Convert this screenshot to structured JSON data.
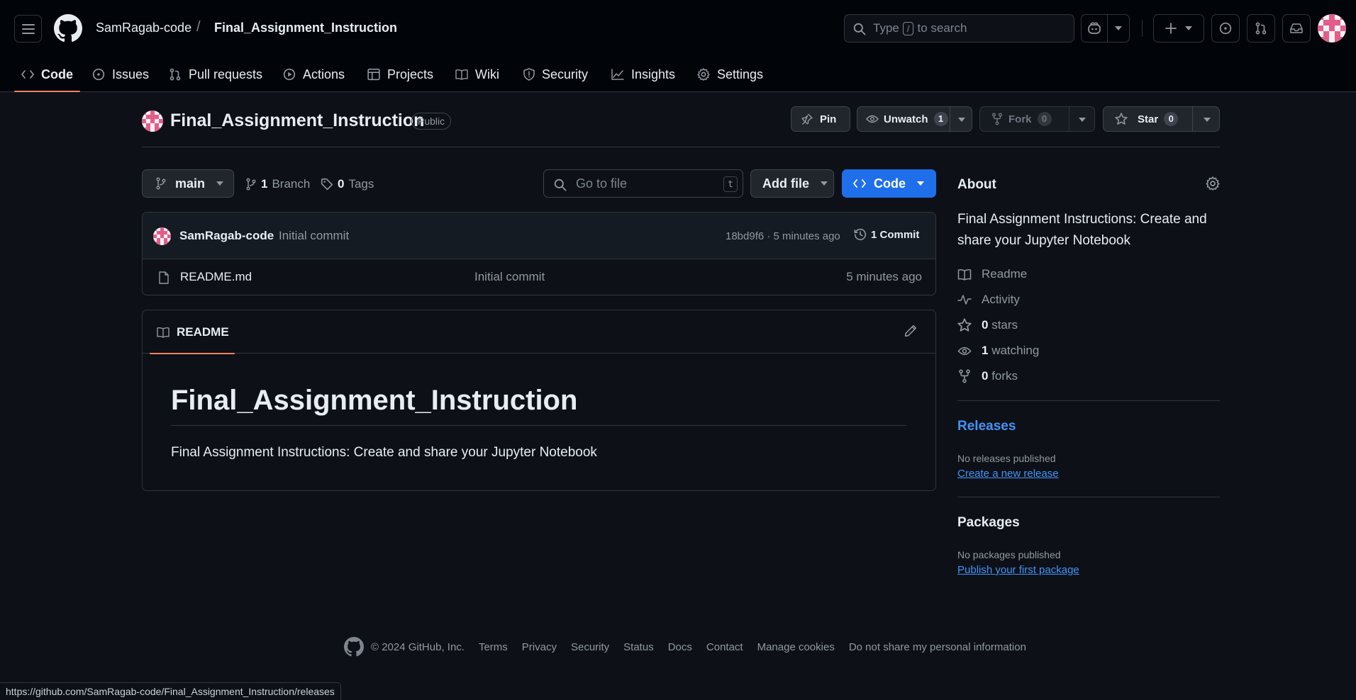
{
  "header": {
    "owner": "SamRagab-code",
    "separator": "/",
    "repo": "Final_Assignment_Instruction",
    "search": {
      "prefix": "Type",
      "key": "/",
      "suffix": "to search"
    }
  },
  "nav": {
    "items": [
      {
        "label": "Code",
        "icon": "code-icon"
      },
      {
        "label": "Issues",
        "icon": "issue-icon"
      },
      {
        "label": "Pull requests",
        "icon": "pull-request-icon"
      },
      {
        "label": "Actions",
        "icon": "play-icon"
      },
      {
        "label": "Projects",
        "icon": "table-icon"
      },
      {
        "label": "Wiki",
        "icon": "book-icon"
      },
      {
        "label": "Security",
        "icon": "shield-icon"
      },
      {
        "label": "Insights",
        "icon": "graph-icon"
      },
      {
        "label": "Settings",
        "icon": "gear-icon"
      }
    ],
    "active": "Code"
  },
  "repo_head": {
    "title": "Final_Assignment_Instruction",
    "visibility": "Public",
    "pin_label": "Pin",
    "unwatch_label": "Unwatch",
    "watch_count": "1",
    "fork_label": "Fork",
    "fork_count": "0",
    "star_label": "Star",
    "star_count": "0"
  },
  "branch_bar": {
    "branch": "main",
    "branch_count": "1",
    "branch_label": "Branch",
    "tag_count": "0",
    "tag_label": "Tags",
    "goto_placeholder": "Go to file",
    "goto_key": "t",
    "add_file_label": "Add file",
    "code_label": "Code"
  },
  "commit": {
    "author": "SamRagab-code",
    "message": "Initial commit",
    "hash_time": "18bd9f6 · 5 minutes ago",
    "count_label": "1 Commit"
  },
  "files": [
    {
      "name": "README.md",
      "commit": "Initial commit",
      "time": "5 minutes ago"
    }
  ],
  "readme": {
    "tab_label": "README",
    "heading": "Final_Assignment_Instruction",
    "body": "Final Assignment Instructions: Create and share your Jupyter Notebook"
  },
  "about": {
    "heading": "About",
    "description": "Final Assignment Instructions: Create and share your Jupyter Notebook",
    "readme": "Readme",
    "activity": "Activity",
    "stars_count": "0",
    "stars_label": "stars",
    "watching_count": "1",
    "watching_label": "watching",
    "forks_count": "0",
    "forks_label": "forks"
  },
  "releases": {
    "heading": "Releases",
    "empty": "No releases published",
    "link": "Create a new release"
  },
  "packages": {
    "heading": "Packages",
    "empty": "No packages published",
    "link": "Publish your first package"
  },
  "footer": {
    "copyright": "© 2024 GitHub, Inc.",
    "links": [
      "Terms",
      "Privacy",
      "Security",
      "Status",
      "Docs",
      "Contact",
      "Manage cookies",
      "Do not share my personal information"
    ]
  },
  "status_url": "https://github.com/SamRagab-code/Final_Assignment_Instruction/releases",
  "colors": {
    "background": "#0d1117",
    "header": "#010409",
    "accent_blue": "#1f6feb",
    "link": "#4493f8",
    "underline_active": "#f78166",
    "avatar_pink": "#e35c8a"
  }
}
